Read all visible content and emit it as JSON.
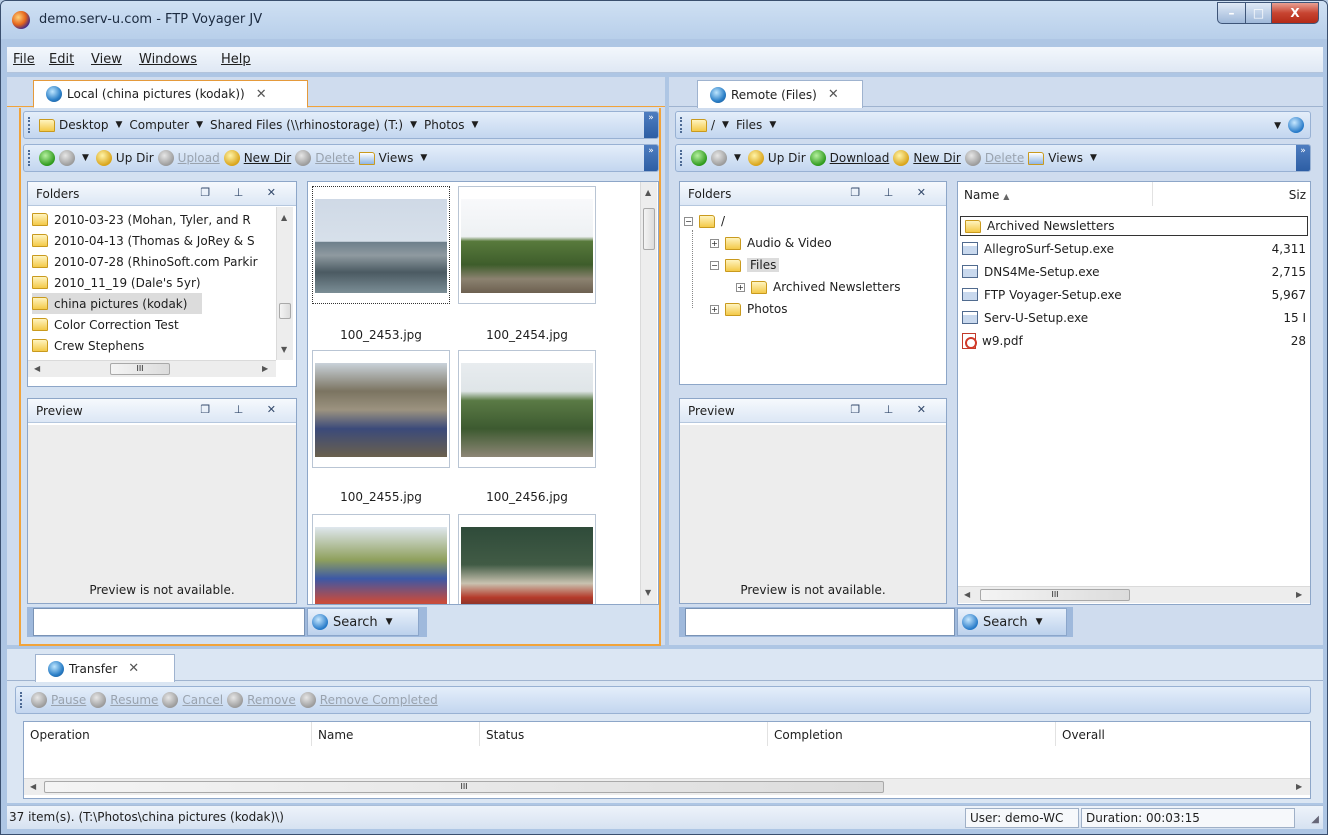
{
  "window": {
    "title": "demo.serv-u.com - FTP Voyager JV",
    "controls": {
      "minimize": "–",
      "maximize": "□",
      "close": "X"
    }
  },
  "menu": [
    "File",
    "Edit",
    "View",
    "Windows",
    "Help"
  ],
  "local": {
    "tab_label": "Local (china pictures (kodak))",
    "breadcrumb": [
      "Desktop",
      "Computer",
      "Shared Files (\\\\rhinostorage) (T:)",
      "Photos"
    ],
    "toolbar": {
      "up_dir": "Up Dir",
      "upload": "Upload",
      "new_dir": "New Dir",
      "delete": "Delete",
      "views": "Views"
    },
    "folders_title": "Folders",
    "folders": [
      "2010-03-23 (Mohan, Tyler, and R",
      "2010-04-13 (Thomas & JoRey & S",
      "2010-07-28 (RhinoSoft.com Parkir",
      "2010_11_19 (Dale's 5yr)",
      "china pictures (kodak)",
      "Color Correction Test",
      "Crew Stephens"
    ],
    "scroll_label": "III",
    "preview_title": "Preview",
    "preview_text": "Preview is not available.",
    "thumbnails": [
      {
        "name": "100_2453.jpg"
      },
      {
        "name": "100_2454.jpg"
      },
      {
        "name": "100_2455.jpg"
      },
      {
        "name": "100_2456.jpg"
      },
      {
        "name": ""
      },
      {
        "name": ""
      }
    ],
    "search_label": "Search"
  },
  "remote": {
    "tab_label": "Remote (Files)",
    "breadcrumb": [
      "/",
      "Files"
    ],
    "toolbar": {
      "up_dir": "Up Dir",
      "download": "Download",
      "new_dir": "New Dir",
      "delete": "Delete",
      "views": "Views"
    },
    "folders_title": "Folders",
    "tree": {
      "root": "/",
      "children": [
        "Audio & Video",
        "Files",
        "Archived Newsletters",
        "Photos"
      ]
    },
    "preview_title": "Preview",
    "preview_text": "Preview is not available.",
    "columns": {
      "name": "Name",
      "size": "Siz"
    },
    "files": [
      {
        "name": "Archived Newsletters",
        "size": ""
      },
      {
        "name": "AllegroSurf-Setup.exe",
        "size": "4,311"
      },
      {
        "name": "DNS4Me-Setup.exe",
        "size": "2,715"
      },
      {
        "name": "FTP Voyager-Setup.exe",
        "size": "5,967"
      },
      {
        "name": "Serv-U-Setup.exe",
        "size": "15 I"
      },
      {
        "name": "w9.pdf",
        "size": "28"
      }
    ],
    "scroll_label": "III",
    "search_label": "Search"
  },
  "transfer": {
    "tab_label": "Transfer",
    "toolbar": {
      "pause": "Pause",
      "resume": "Resume",
      "cancel": "Cancel",
      "remove": "Remove",
      "remove_completed": "Remove Completed"
    },
    "columns": [
      "Operation",
      "Name",
      "Status",
      "Completion",
      "Overall"
    ],
    "scroll_label": "III"
  },
  "status": {
    "items": "37 item(s).  (T:\\Photos\\china pictures (kodak)\\)",
    "user": "User: demo-WC",
    "duration": "Duration:  00:03:15"
  },
  "colors": {
    "accent_orange": "#f1a33a",
    "bar_blue": "#9fb9dc"
  }
}
